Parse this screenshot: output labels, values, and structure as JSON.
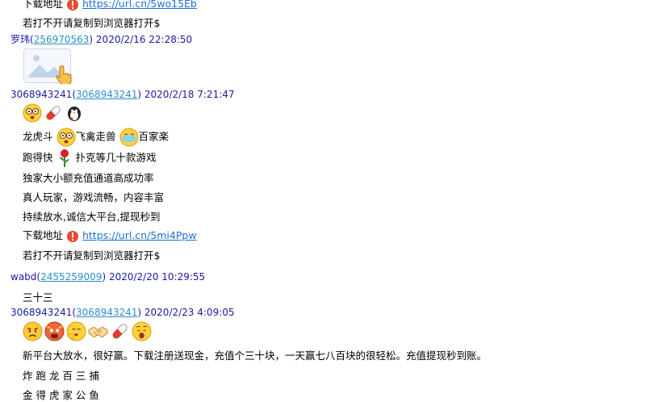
{
  "top": {
    "download_label": "下载地址",
    "link1": "https://url.cn/5wo15Eb",
    "open_hint": "若打不开请复制到浏览器打开$"
  },
  "messages": [
    {
      "sender": "罗玮",
      "qq": "256970563",
      "time": "2020/2/16 22:28:50",
      "image_icon": "broken-image-placeholder"
    },
    {
      "sender": "3068943241",
      "qq": "3068943241",
      "time": "2020/2/18 7:21:47",
      "emoji_icons": [
        "dizzy-face-icon",
        "pill-icon",
        "penguin-icon"
      ],
      "lines": {
        "l1a": "龙虎斗",
        "l1b": "飞禽走兽",
        "l1c": "百家楽",
        "l2a": "跑得快",
        "l2b": "扑克等几十款游戏",
        "l3": "独家大小额充值通道高成功率",
        "l4": "真人玩家，游戏流畅，内容丰富",
        "l5": "持续放水,诚信大平台,提现秒到",
        "download_label": "下载地址",
        "link": "https://url.cn/5mi4Ppw",
        "open_hint": "若打不开请复制到浏览器打开$"
      }
    },
    {
      "sender": "wabd",
      "qq": "2455259009",
      "time": "2020/2/20 10:29:55",
      "text": "三十三"
    },
    {
      "sender": "3068943241",
      "qq": "3068943241",
      "time": "2020/2/23 4:09:05",
      "emoji_icons": [
        "angry-face-icon",
        "shocked-face-icon",
        "salute-face-icon",
        "handshake-icon",
        "pill-icon",
        "yawn-face-icon"
      ],
      "lines": {
        "l1": "新平台大放水，很好赢。下载注册送现金，充值个三十块，一天赢七八百块的很轻松。充值提现秒到账。",
        "l2": "炸 跑 龙 百 三 捕",
        "l3": "金 得 虎 家 公 鱼"
      }
    }
  ],
  "colors": {
    "sender": "#1a1aa6",
    "qq_link": "#2c8fc9",
    "url_link": "#1f6fd1",
    "warning": "#e8492f"
  }
}
